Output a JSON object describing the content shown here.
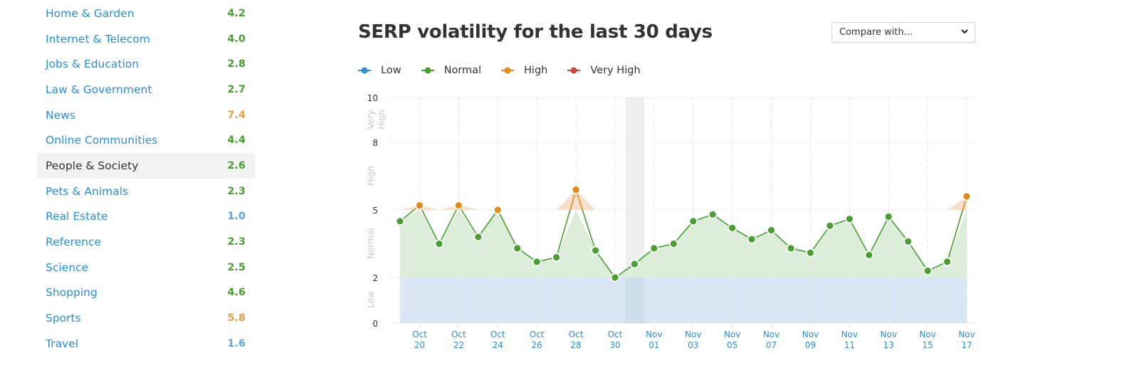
{
  "sidebar": {
    "categories": [
      {
        "name": "Home & Garden",
        "value": "4.2",
        "level": "normal",
        "active": false
      },
      {
        "name": "Internet & Telecom",
        "value": "4.0",
        "level": "normal",
        "active": false
      },
      {
        "name": "Jobs & Education",
        "value": "2.8",
        "level": "normal",
        "active": false
      },
      {
        "name": "Law & Government",
        "value": "2.7",
        "level": "normal",
        "active": false
      },
      {
        "name": "News",
        "value": "7.4",
        "level": "high",
        "active": false
      },
      {
        "name": "Online Communities",
        "value": "4.4",
        "level": "normal",
        "active": false
      },
      {
        "name": "People & Society",
        "value": "2.6",
        "level": "normal",
        "active": true
      },
      {
        "name": "Pets & Animals",
        "value": "2.3",
        "level": "normal",
        "active": false
      },
      {
        "name": "Real Estate",
        "value": "1.0",
        "level": "low",
        "active": false
      },
      {
        "name": "Reference",
        "value": "2.3",
        "level": "normal",
        "active": false
      },
      {
        "name": "Science",
        "value": "2.5",
        "level": "normal",
        "active": false
      },
      {
        "name": "Shopping",
        "value": "4.6",
        "level": "normal",
        "active": false
      },
      {
        "name": "Sports",
        "value": "5.8",
        "level": "high",
        "active": false
      },
      {
        "name": "Travel",
        "value": "1.6",
        "level": "low",
        "active": false
      }
    ]
  },
  "compare": {
    "label": "Compare with...",
    "icon": "chevron-down-icon"
  },
  "colors": {
    "low": "#2d8fd5",
    "normal": "#4a9e32",
    "high": "#e48a1a",
    "very_high": "#c9473a",
    "low_band": "#d6e6f2",
    "normal_fill": "#dceeda",
    "high_fill": "#f6e0cc"
  },
  "chart_data": {
    "type": "line",
    "title": "SERP volatility for the last 30 days",
    "legend": [
      {
        "name": "Low",
        "color": "#2d8fd5"
      },
      {
        "name": "Normal",
        "color": "#4a9e32"
      },
      {
        "name": "High",
        "color": "#e48a1a"
      },
      {
        "name": "Very High",
        "color": "#c9473a"
      }
    ],
    "legend_position": "top-left",
    "y_ticks": [
      0,
      2,
      5,
      8,
      10
    ],
    "y_bands": [
      {
        "label": "Low",
        "from": 0,
        "to": 2
      },
      {
        "label": "Normal",
        "from": 2,
        "to": 5
      },
      {
        "label": "High",
        "from": 5,
        "to": 8
      },
      {
        "label": "Very High",
        "from": 8,
        "to": 10
      }
    ],
    "ylim": [
      0,
      10
    ],
    "x_tick_labels": [
      [
        "Oct",
        "20"
      ],
      [
        "Oct",
        "22"
      ],
      [
        "Oct",
        "24"
      ],
      [
        "Oct",
        "26"
      ],
      [
        "Oct",
        "28"
      ],
      [
        "Oct",
        "30"
      ],
      [
        "Nov",
        "01"
      ],
      [
        "Nov",
        "03"
      ],
      [
        "Nov",
        "05"
      ],
      [
        "Nov",
        "07"
      ],
      [
        "Nov",
        "09"
      ],
      [
        "Nov",
        "11"
      ],
      [
        "Nov",
        "13"
      ],
      [
        "Nov",
        "15"
      ],
      [
        "Nov",
        "17"
      ]
    ],
    "x": [
      "Oct 19",
      "Oct 20",
      "Oct 21",
      "Oct 22",
      "Oct 23",
      "Oct 24",
      "Oct 25",
      "Oct 26",
      "Oct 27",
      "Oct 28",
      "Oct 29",
      "Oct 30",
      "Oct 31",
      "Nov 01",
      "Nov 02",
      "Nov 03",
      "Nov 04",
      "Nov 05",
      "Nov 06",
      "Nov 07",
      "Nov 08",
      "Nov 09",
      "Nov 10",
      "Nov 11",
      "Nov 12",
      "Nov 13",
      "Nov 14",
      "Nov 15",
      "Nov 16",
      "Nov 17"
    ],
    "values": [
      4.5,
      5.2,
      3.5,
      5.2,
      3.8,
      5.0,
      3.3,
      2.7,
      2.9,
      5.9,
      3.2,
      2.0,
      2.6,
      3.3,
      3.5,
      4.5,
      4.8,
      4.2,
      3.7,
      4.1,
      3.3,
      3.1,
      4.3,
      4.6,
      3.0,
      4.7,
      3.6,
      2.3,
      2.7,
      5.6
    ],
    "highlighted_x": "Oct 31",
    "grid": true,
    "xlabel": "",
    "ylabel": ""
  }
}
